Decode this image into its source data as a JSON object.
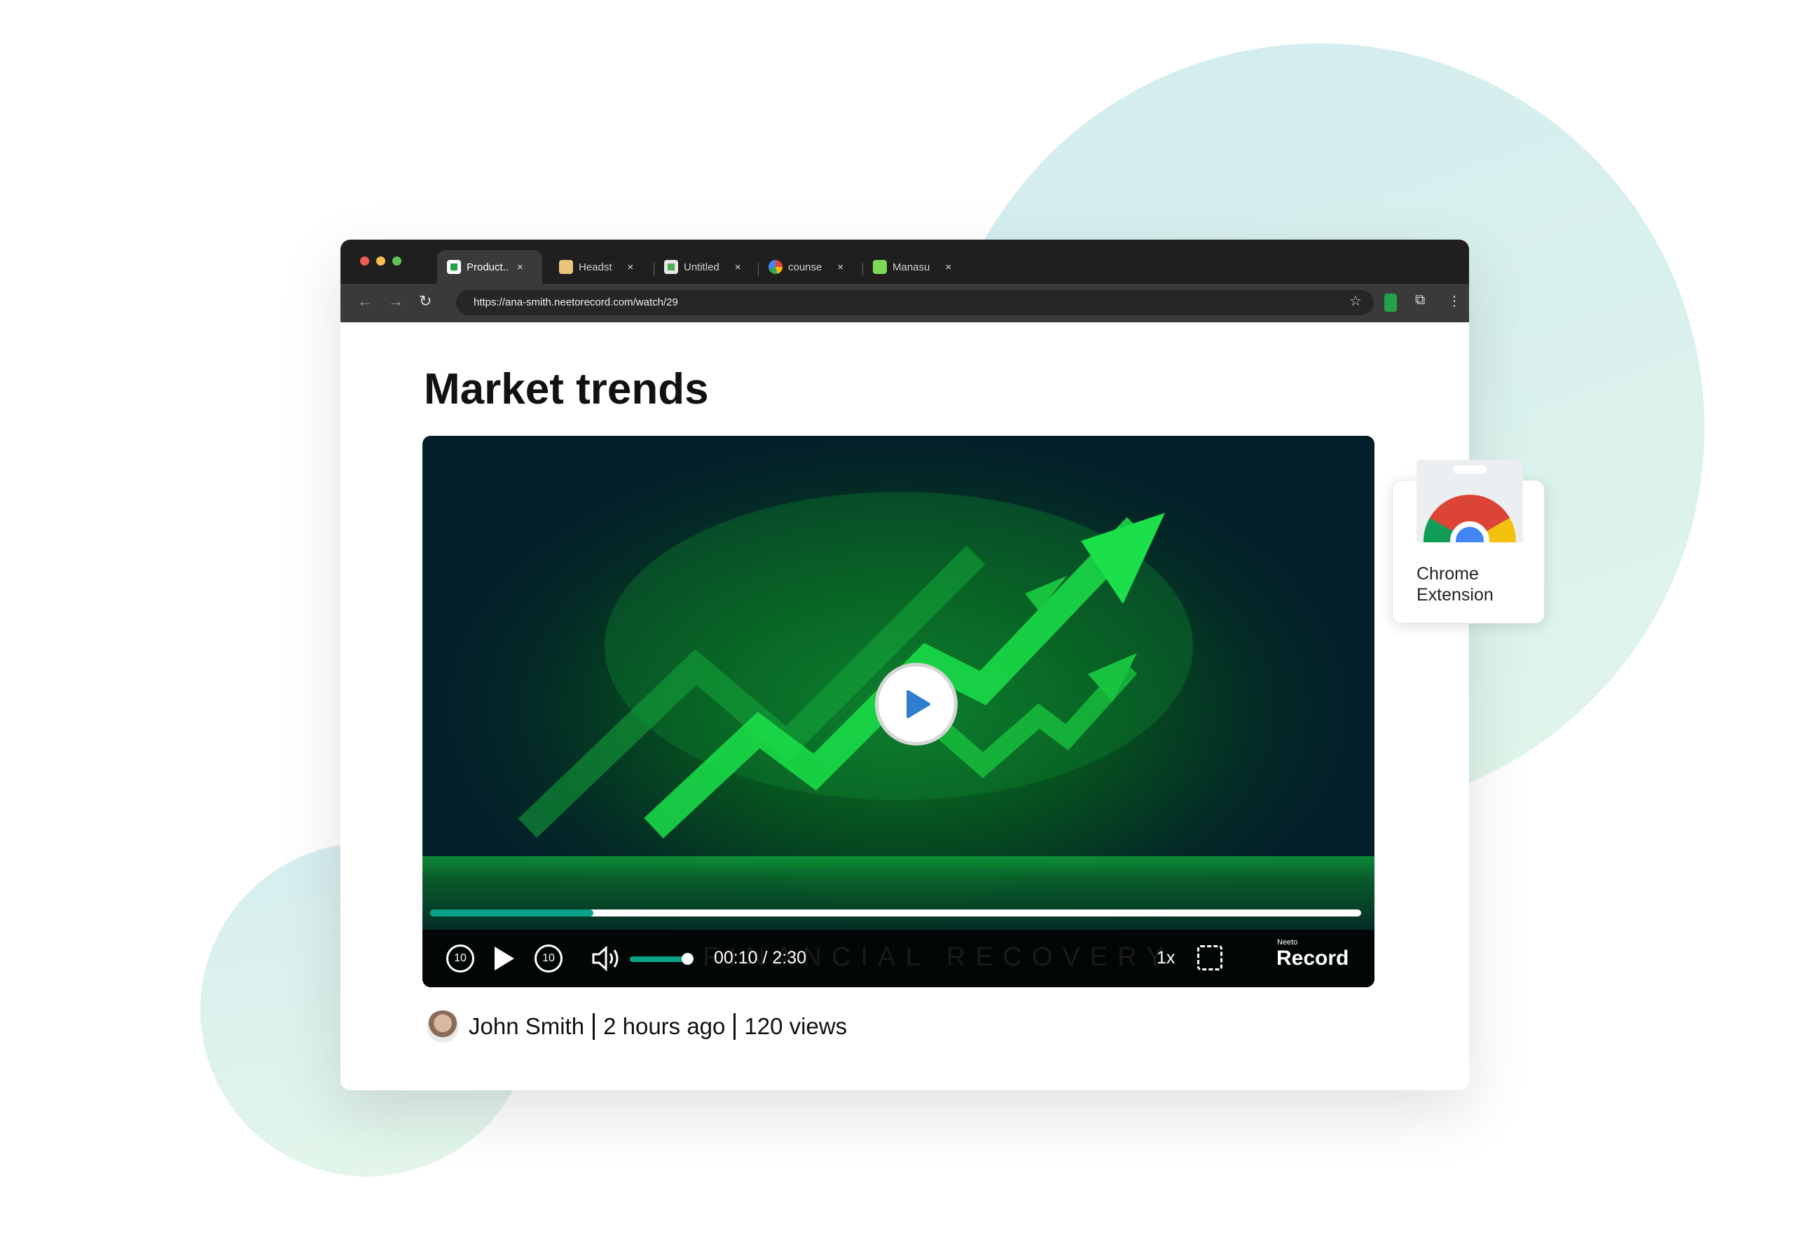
{
  "browser": {
    "tabs": [
      {
        "label": "Product..",
        "active": true,
        "favicon": "neeto-record-icon"
      },
      {
        "label": "Headst",
        "favicon": "image-icon"
      },
      {
        "label": "Untitled",
        "favicon": "sheet-icon"
      },
      {
        "label": "counse",
        "favicon": "google-icon"
      },
      {
        "label": "Manasu",
        "favicon": "app-icon"
      }
    ],
    "close_glyph": "×",
    "url": "https://ana-smith.neetorecord.com/watch/29"
  },
  "page": {
    "title": "Market trends"
  },
  "video": {
    "watermark": "FINANCIAL RECOVERY",
    "progress_fraction": 0.175,
    "volume_fraction": 0.85,
    "current_time": "00:10",
    "duration": "2:30",
    "time_display": "00:10 / 2:30",
    "speed": "1x",
    "skip_back": "10",
    "skip_forward": "10",
    "brand_small": "Neeto",
    "brand_large": "Record",
    "accent_color": "#0aa386"
  },
  "meta": {
    "author": "John Smith",
    "posted": "2 hours ago",
    "views": "120 views"
  },
  "extension_card": {
    "line1": "Chrome",
    "line2": "Extension"
  }
}
